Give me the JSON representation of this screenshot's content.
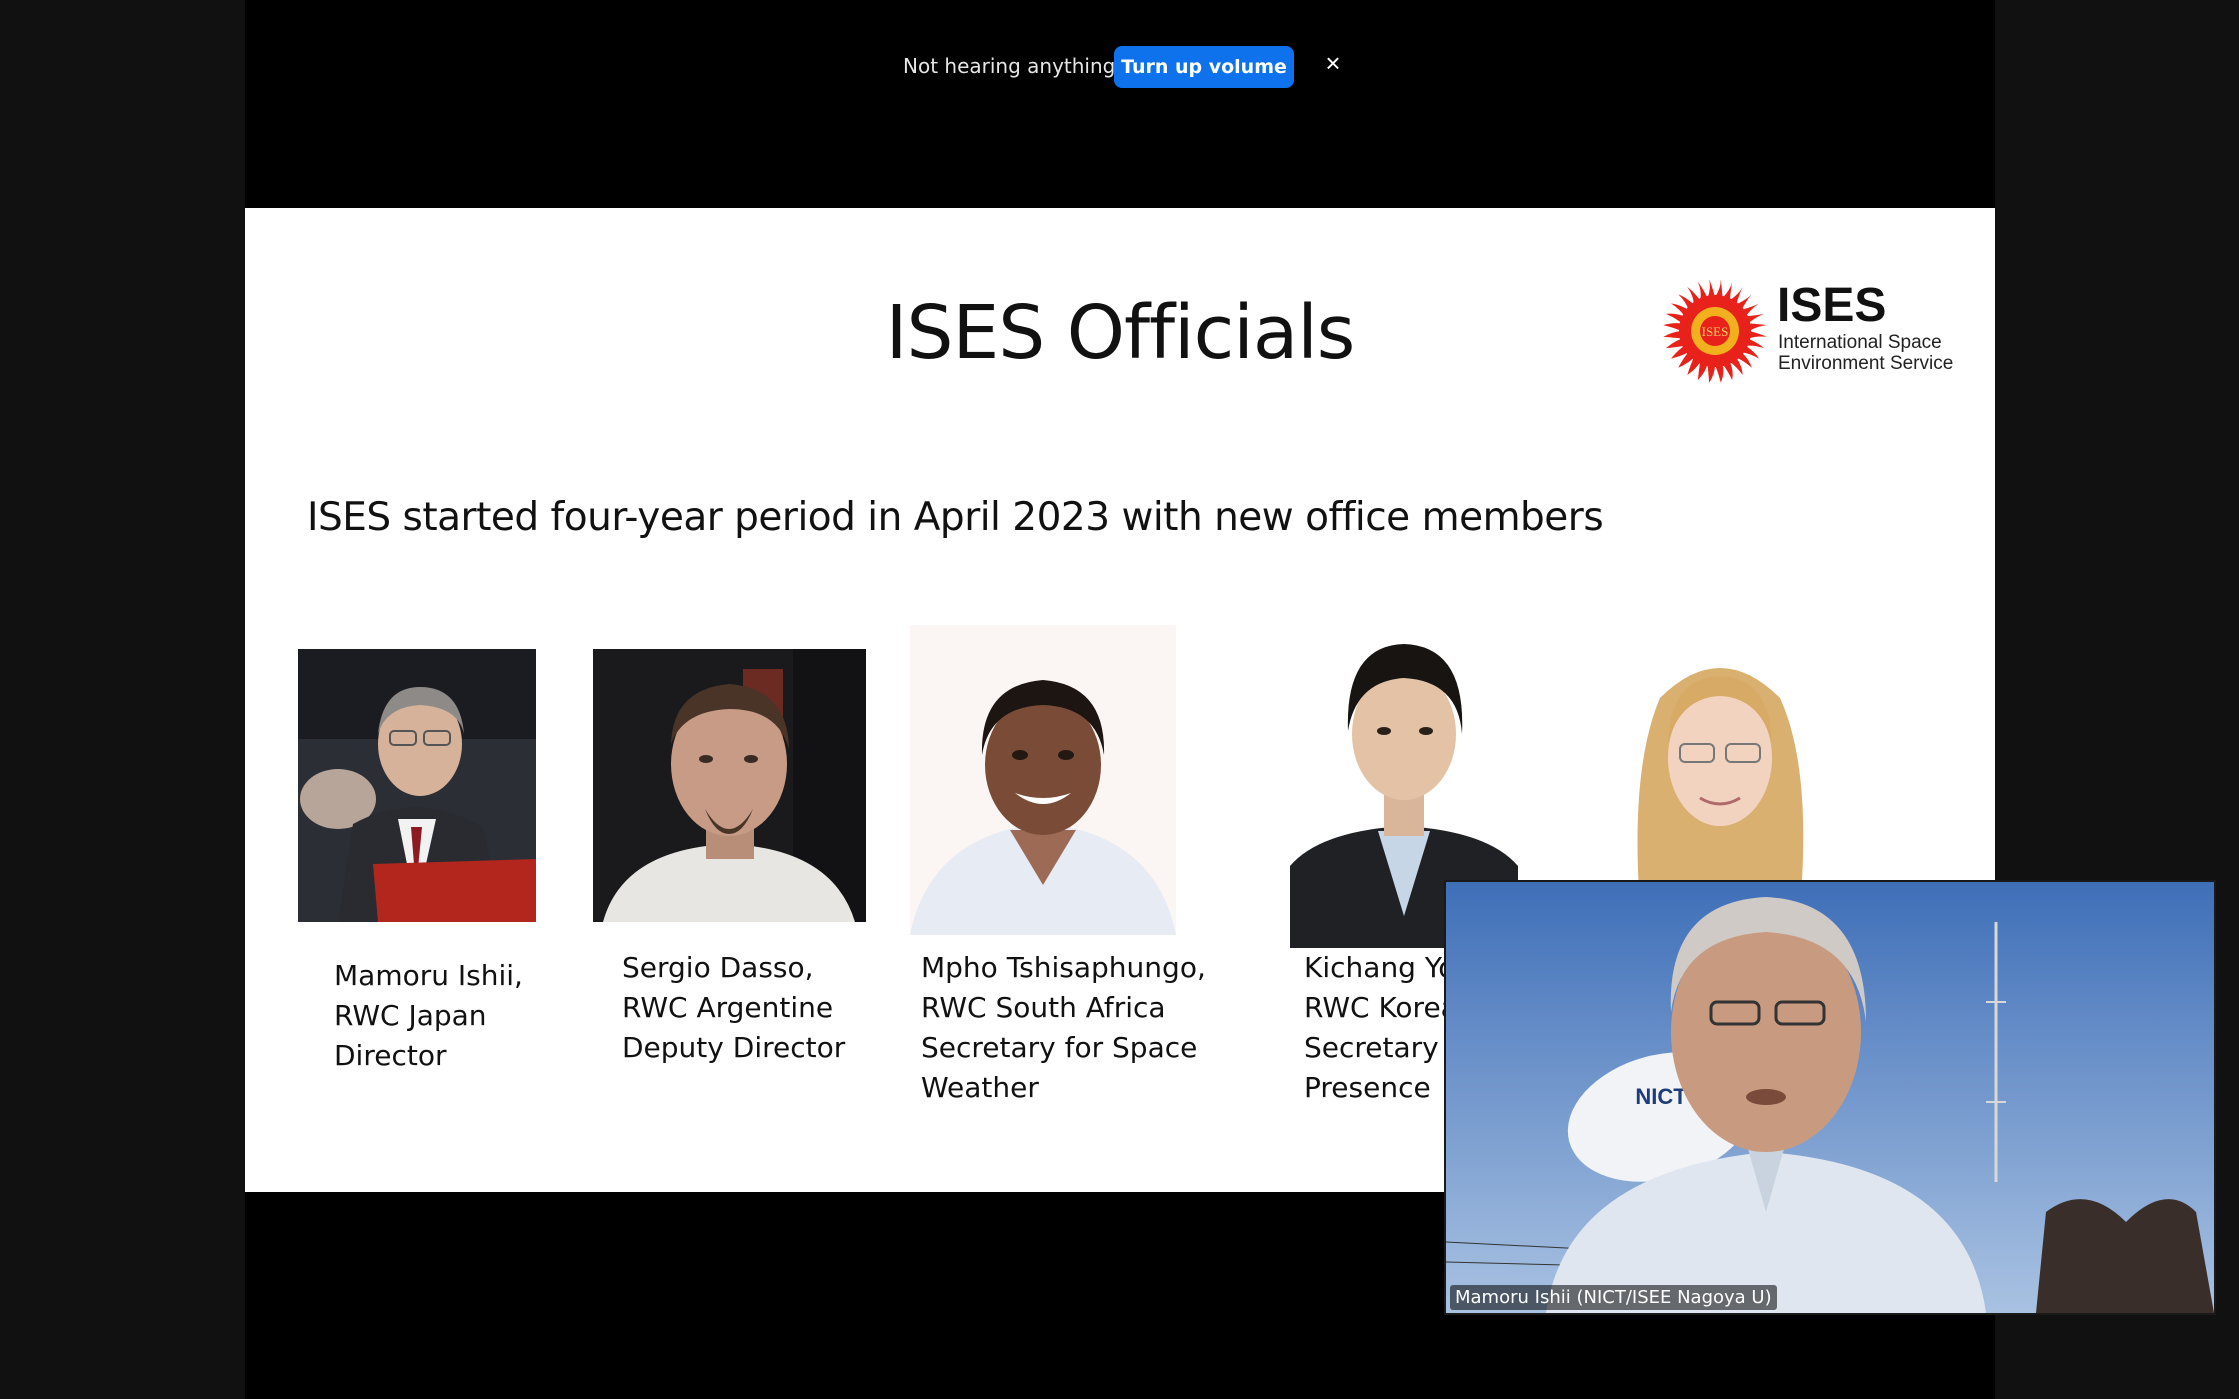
{
  "notification": {
    "text": "Not hearing anything?",
    "button_label": "Turn up volume",
    "close_glyph": "×",
    "button_color": "#0e72ed"
  },
  "slide": {
    "title": "ISES Officials",
    "logo": {
      "name": "ISES",
      "tagline_line1": "International Space",
      "tagline_line2": "Environment Service",
      "emblem_text": "ISES",
      "emblem_color": "#e8221a"
    },
    "subtitle": "ISES started four-year period in April 2023 with new office members",
    "officials": [
      {
        "caption": "Mamoru Ishii,\nRWC Japan\nDirector"
      },
      {
        "caption": "Sergio Dasso,\nRWC Argentine\nDeputy Director"
      },
      {
        "caption": "Mpho Tshisaphungo,\nRWC South Africa\nSecretary for Space\nWeather"
      },
      {
        "caption": "Kichang Yo\nRWC Korea\nSecretary o\nPresence"
      },
      {
        "caption": ""
      }
    ]
  },
  "video": {
    "participant_name": "Mamoru Ishii (NICT/ISEE Nagoya U)",
    "dish_text": "NICT"
  }
}
